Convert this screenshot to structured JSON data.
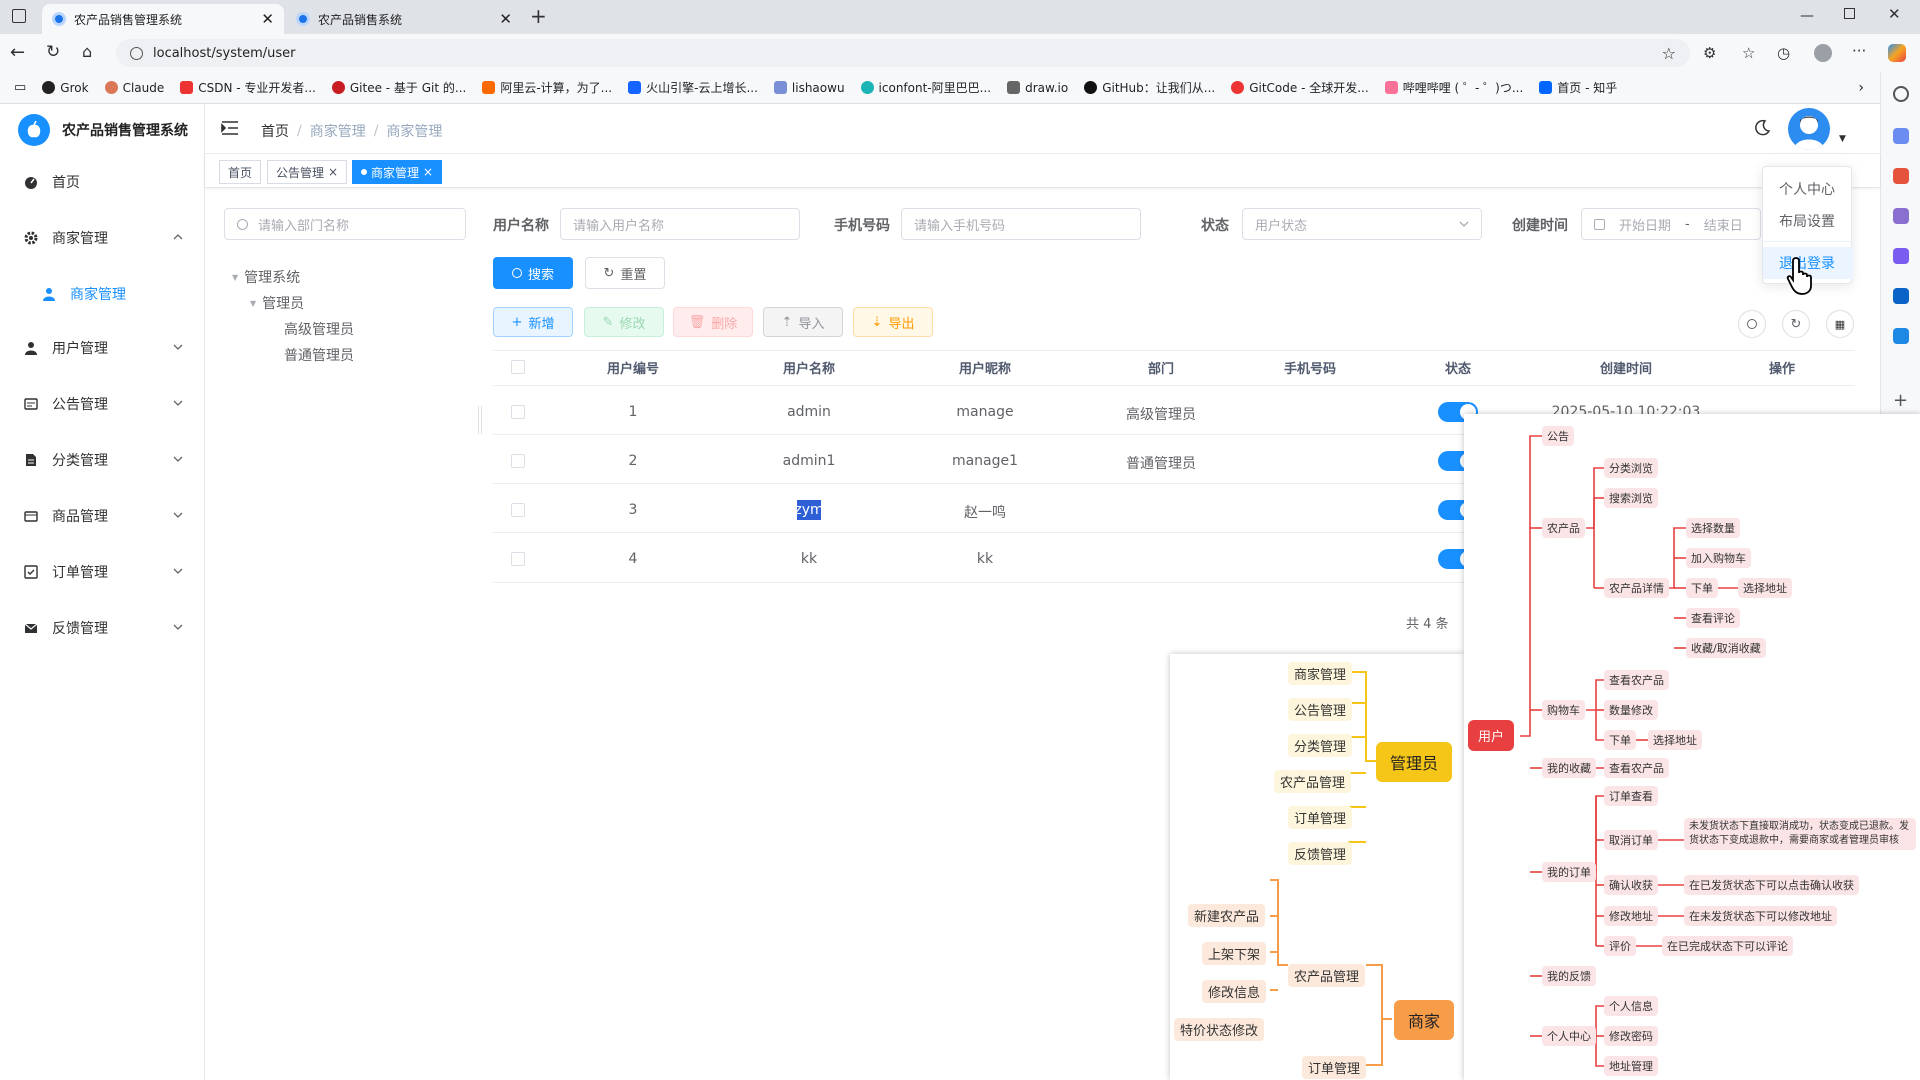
{
  "browser": {
    "tabs": [
      {
        "title": "农产品销售管理系统",
        "active": true
      },
      {
        "title": "农产品销售系统",
        "active": false
      }
    ],
    "url": "localhost/system/user",
    "bookmarks": [
      "Grok",
      "Claude",
      "CSDN - 专业开发者...",
      "Gitee - 基于 Git 的...",
      "阿里云-计算，为了...",
      "火山引擎-云上增长...",
      "lishaowu",
      "iconfont-阿里巴巴...",
      "draw.io",
      "GitHub：让我们从...",
      "GitCode - 全球开发...",
      "哔哩哔哩 ( ゜- ゜)つ...",
      "首页 - 知乎"
    ]
  },
  "app": {
    "title": "农产品销售管理系统",
    "sidebar": [
      {
        "label": "首页",
        "icon": "dashboard-icon"
      },
      {
        "label": "商家管理",
        "icon": "gear-icon",
        "expanded": true
      },
      {
        "label": "商家管理",
        "icon": "user-icon",
        "sub": true,
        "active": true
      },
      {
        "label": "用户管理",
        "icon": "user-icon"
      },
      {
        "label": "公告管理",
        "icon": "notice-icon"
      },
      {
        "label": "分类管理",
        "icon": "document-icon"
      },
      {
        "label": "商品管理",
        "icon": "goods-icon"
      },
      {
        "label": "订单管理",
        "icon": "order-icon"
      },
      {
        "label": "反馈管理",
        "icon": "mail-icon"
      }
    ],
    "breadcrumb": [
      "首页",
      "商家管理",
      "商家管理"
    ],
    "breadcrumb_sep": "/",
    "tags": [
      {
        "label": "首页"
      },
      {
        "label": "公告管理",
        "close": "×"
      },
      {
        "label": "商家管理",
        "close": "×",
        "active": true
      }
    ],
    "user_dropdown": [
      "个人中心",
      "布局设置",
      "退出登录"
    ]
  },
  "dept": {
    "search_placeholder": "请输入部门名称",
    "tree": [
      {
        "label": "管理系统",
        "level": 0
      },
      {
        "label": "管理员",
        "level": 1
      },
      {
        "label": "高级管理员",
        "level": 2
      },
      {
        "label": "普通管理员",
        "level": 2
      }
    ]
  },
  "filter": {
    "username_label": "用户名称",
    "username_placeholder": "请输入用户名称",
    "phone_label": "手机号码",
    "phone_placeholder": "请输入手机号码",
    "status_label": "状态",
    "status_placeholder": "用户状态",
    "created_label": "创建时间",
    "start_placeholder": "开始日期",
    "range_sep": "-",
    "end_placeholder": "结束日",
    "search_btn": "搜索",
    "reset_btn": "重置"
  },
  "toolbar": {
    "add": "新增",
    "edit": "修改",
    "delete": "删除",
    "import": "导入",
    "export": "导出"
  },
  "table": {
    "columns": [
      "用户编号",
      "用户名称",
      "用户昵称",
      "部门",
      "手机号码",
      "状态",
      "创建时间",
      "操作"
    ],
    "rows": [
      {
        "id": "1",
        "username": "admin",
        "nickname": "manage",
        "dept": "高级管理员",
        "phone": "",
        "status": true,
        "created": "2025-05-10 10:22:03"
      },
      {
        "id": "2",
        "username": "admin1",
        "nickname": "manage1",
        "dept": "普通管理员",
        "phone": "",
        "status": true,
        "created": ""
      },
      {
        "id": "3",
        "username": "zym",
        "nickname": "赵一鸣",
        "dept": "",
        "phone": "",
        "status": true,
        "created": ""
      },
      {
        "id": "4",
        "username": "kk",
        "nickname": "kk",
        "dept": "",
        "phone": "",
        "status": true,
        "created": ""
      }
    ],
    "total": "共 4 条"
  },
  "mindmap_admin": {
    "admin_root": "管理员",
    "admin_children": [
      "商家管理",
      "公告管理",
      "分类管理",
      "农产品管理",
      "订单管理",
      "反馈管理"
    ],
    "merchant_root": "商家",
    "merchant_mid": "农产品管理",
    "merchant_leaf": [
      "新建农产品",
      "上架下架",
      "修改信息",
      "特价状态修改"
    ],
    "merchant_order": "订单管理"
  },
  "mindmap_user": {
    "root": "用户",
    "notice": "公告",
    "product": "农产品",
    "product_children": [
      "分类浏览",
      "搜索浏览",
      "农产品详情"
    ],
    "detail_children": [
      "选择数量",
      "加入购物车",
      "下单",
      "查看评论",
      "收藏/取消收藏"
    ],
    "choose_addr": "选择地址",
    "cart": "购物车",
    "cart_children": [
      "查看农产品",
      "数量修改",
      "下单"
    ],
    "cart_addr": "选择地址",
    "favorites": "我的收藏",
    "fav_child": "查看农产品",
    "orders": "我的订单",
    "order_children": [
      "订单查看",
      "取消订单",
      "确认收获",
      "修改地址",
      "评价"
    ],
    "cancel_note": "未发货状态下直接取消成功，状态变成已退款。发货状态下变成退款中，需要商家或者管理员审核",
    "confirm_note": "在已发货状态下可以点击确认收获",
    "addr_note": "在未发货状态下可以修改地址",
    "review_note": "在已完成状态下可以评论",
    "feedback": "我的反馈",
    "profile": "个人中心",
    "profile_children": [
      "个人信息",
      "修改密码",
      "地址管理"
    ]
  },
  "colors": {
    "primary": "#1890ff",
    "admin_node": "#f5c518",
    "merchant_node": "#f79d4a",
    "user_node": "#e84040"
  }
}
